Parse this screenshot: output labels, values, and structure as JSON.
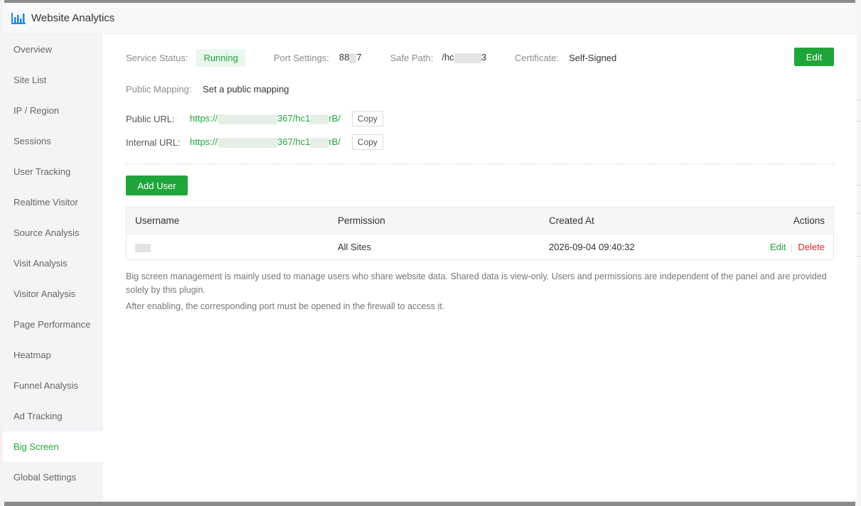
{
  "app": {
    "title": "Website Analytics"
  },
  "sidebar": {
    "items": [
      {
        "label": "Overview"
      },
      {
        "label": "Site List"
      },
      {
        "label": "IP / Region"
      },
      {
        "label": "Sessions"
      },
      {
        "label": "User Tracking"
      },
      {
        "label": "Realtime Visitor"
      },
      {
        "label": "Source Analysis"
      },
      {
        "label": "Visit Analysis"
      },
      {
        "label": "Visitor Analysis"
      },
      {
        "label": "Page Performance"
      },
      {
        "label": "Heatmap"
      },
      {
        "label": "Funnel Analysis"
      },
      {
        "label": "Ad Tracking"
      },
      {
        "label": "Big Screen",
        "active": true
      },
      {
        "label": "Global Settings"
      }
    ]
  },
  "service": {
    "status_label": "Service Status:",
    "status_value": "Running",
    "port_label": "Port Settings:",
    "port_prefix": "88",
    "port_suffix": "7",
    "safe_path_label": "Safe Path:",
    "safe_path_prefix": "/hc",
    "safe_path_suffix": "3",
    "cert_label": "Certificate:",
    "cert_value": "Self-Signed",
    "edit_label": "Edit"
  },
  "mapping": {
    "label": "Public Mapping:",
    "value": "Set a public mapping"
  },
  "urls": {
    "public_label": "Public URL:",
    "public_prefix": "https://",
    "public_mid": "367/hc1",
    "public_suffix": "rB/",
    "internal_label": "Internal URL:",
    "internal_prefix": "https://",
    "internal_mid": "367/hc1",
    "internal_suffix": "rB/",
    "copy_label": "Copy"
  },
  "add_user_label": "Add User",
  "table": {
    "headers": [
      "Username",
      "Permission",
      "Created At",
      "Actions"
    ],
    "rows": [
      {
        "username": "",
        "permission": "All Sites",
        "created_at": "2026-09-04 09:40:32",
        "edit": "Edit",
        "delete": "Delete"
      }
    ]
  },
  "notes": [
    "Big screen management is mainly used to manage users who share website data. Shared data is view-only. Users and permissions are independent of the panel and are provided solely by this plugin.",
    "After enabling, the corresponding port must be opened in the firewall to access it."
  ],
  "colors": {
    "accent": "#20a53a",
    "danger": "#e02424"
  }
}
